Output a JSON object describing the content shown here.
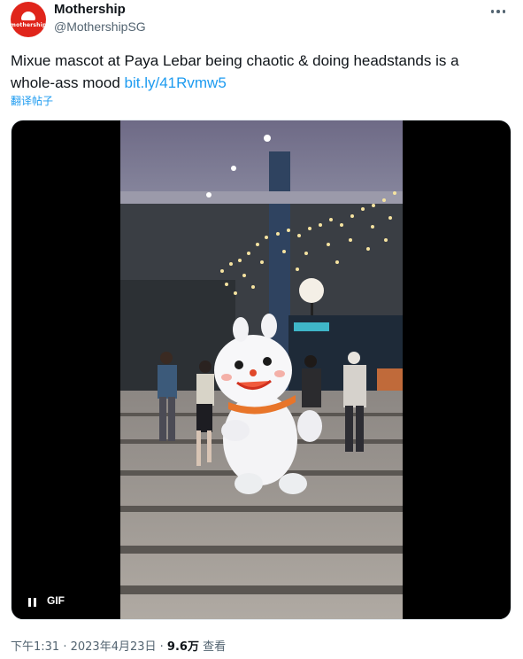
{
  "author": {
    "name": "Mothership",
    "handle": "@MothershipSG",
    "avatar_text": "mothership",
    "avatar_color": "#e0251b"
  },
  "tweet": {
    "text": "Mixue mascot at Paya Lebar being chaotic & doing headstands is a whole-ass mood ",
    "link": "bit.ly/41Rvmw5",
    "translate_label": "翻译帖子"
  },
  "media": {
    "badge": "GIF",
    "pause_icon": "pause-icon"
  },
  "meta": {
    "time": "下午1:31",
    "separator": " · ",
    "date": "2023年4月23日",
    "views_count": "9.6万",
    "views_label": " 查看"
  },
  "colors": {
    "link": "#1d9bf0",
    "secondary_text": "#536471",
    "primary_text": "#0f1419"
  }
}
